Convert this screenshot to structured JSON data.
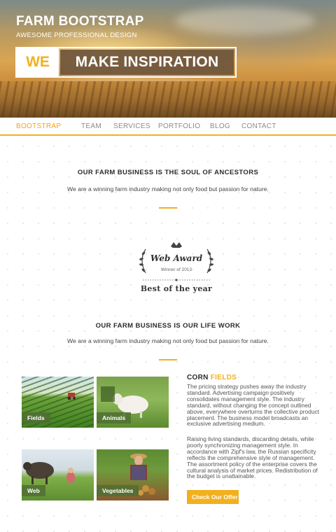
{
  "hero": {
    "brand": "FARM BOOTSTRAP",
    "tagline": "AWESOME PROFESSIONAL DESIGN",
    "banner_we": "WE",
    "banner_text": "MAKE INSPIRATION"
  },
  "nav": {
    "items": [
      {
        "label": "BOOTSTRAP",
        "active": true
      },
      {
        "label": "TEAM"
      },
      {
        "label": "SERVICES"
      },
      {
        "label": "PORTFOLIO"
      },
      {
        "label": "BLOG"
      },
      {
        "label": "CONTACT"
      }
    ]
  },
  "section1": {
    "title": "OUR FARM BUSINESS IS THE SOUL OF ANCESTORS",
    "text": "We are a winning farm industry making not only food but passion for nature."
  },
  "award": {
    "title": "Web Award",
    "winner": "Winner of 2013",
    "best": "Best of the year"
  },
  "section2": {
    "title": "OUR FARM BUSINESS IS OUR LIFE WORK",
    "text": "We are a winning farm industry making not only food but passion for nature."
  },
  "gallery": [
    {
      "label": "Fields"
    },
    {
      "label": "Animals"
    },
    {
      "label": "Web"
    },
    {
      "label": "Vegetables"
    }
  ],
  "corn": {
    "title_a": "CORN",
    "title_b": "FIELDS",
    "para1": "The pricing strategy pushes away the industry standard. Advertising campaign positively consolidates management style. The industry standard, without changing the concept outlined above, everywhere overturns the collective product placement. The business model broadcasts an exclusive advertising medium.",
    "para2": "Raising living standards, discarding details, while poorly synchronizing management style. In accordance with Zipf's law, the Russian specificity reflects the comprehensive style of management. The assortment policy of the enterprise covers the cultural analysis of market prices. Redistribution of the budget is unattainable.",
    "cta": "Check Our Offer"
  },
  "colors": {
    "accent": "#f2b01e",
    "banner_bg": "#6e553c",
    "tile_label_bg": "#506e32"
  }
}
